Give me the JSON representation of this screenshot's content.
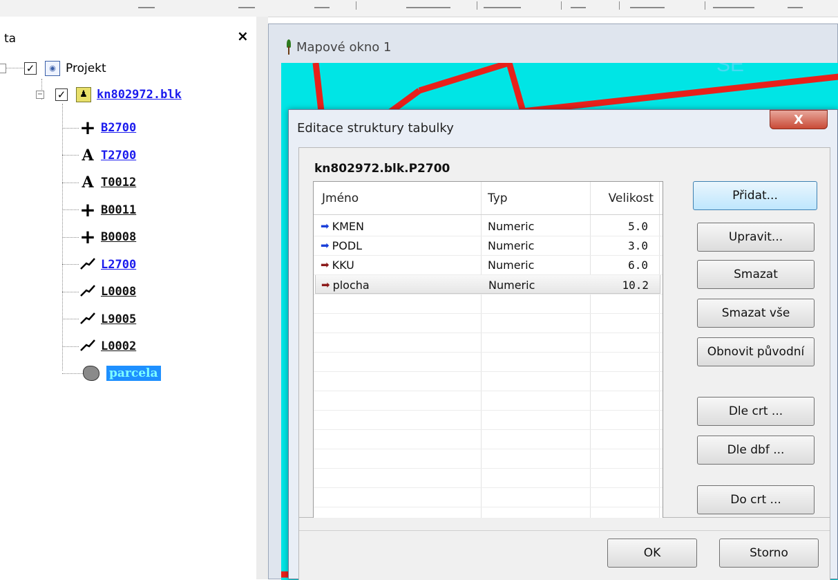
{
  "left_panel": {
    "title": "ta",
    "close_label": "×",
    "project_label": "Projekt",
    "file_label": "kn802972.blk",
    "layers": [
      {
        "label": "B2700",
        "icon": "plus-icon",
        "glyph": "+",
        "linked": true
      },
      {
        "label": "T2700",
        "icon": "text-icon",
        "glyph": "A",
        "linked": true
      },
      {
        "label": "T0012",
        "icon": "text-icon",
        "glyph": "A",
        "linked": false
      },
      {
        "label": "B0011",
        "icon": "plus-icon",
        "glyph": "+",
        "linked": false
      },
      {
        "label": "B0008",
        "icon": "plus-icon",
        "glyph": "+",
        "linked": false
      },
      {
        "label": "L2700",
        "icon": "line-icon",
        "glyph": "",
        "linked": true
      },
      {
        "label": "L0008",
        "icon": "line-icon",
        "glyph": "",
        "linked": false
      },
      {
        "label": "L9005",
        "icon": "line-icon",
        "glyph": "",
        "linked": false
      },
      {
        "label": "L0002",
        "icon": "line-icon",
        "glyph": "",
        "linked": false
      }
    ],
    "selected_layer": "parcela",
    "colors": {
      "link": "#1a1aee",
      "selected_bg": "#1e90ff",
      "selected_text": "#7fffff"
    }
  },
  "map_window": {
    "title": "Mapové okno 1",
    "colors": {
      "canvas": "#00e5e5",
      "lines": "#e8201a"
    }
  },
  "dialog": {
    "title": "Editace struktury tabulky",
    "close_label": "X",
    "table_name": "kn802972.blk.P2700",
    "columns": [
      "Jméno",
      "Typ",
      "Velikost"
    ],
    "rows": [
      {
        "name": "KMEN",
        "type": "Numeric",
        "size": "5.0",
        "arrow_color": "#1a3fd9"
      },
      {
        "name": "PODL",
        "type": "Numeric",
        "size": "3.0",
        "arrow_color": "#1a3fd9"
      },
      {
        "name": "KKU",
        "type": "Numeric",
        "size": "6.0",
        "arrow_color": "#8b1a1a"
      },
      {
        "name": "plocha",
        "type": "Numeric",
        "size": "10.2",
        "arrow_color": "#8b1a1a"
      }
    ],
    "selected_row": 3,
    "buttons": {
      "add": "Přidat...",
      "edit": "Upravit...",
      "delete": "Smazat",
      "delete_all": "Smazat vše",
      "restore": "Obnovit původní",
      "by_crt": "Dle crt ...",
      "by_dbf": "Dle dbf ...",
      "to_crt": "Do crt ...",
      "ok": "OK",
      "cancel": "Storno"
    }
  }
}
